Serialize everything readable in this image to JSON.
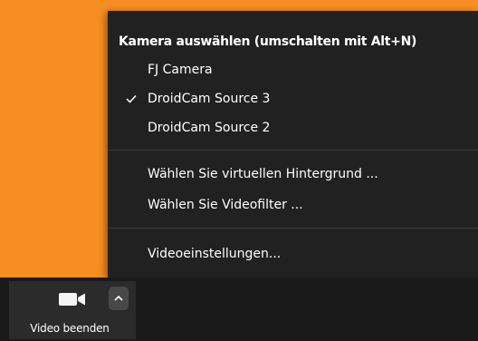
{
  "camera_menu": {
    "header": "Kamera auswählen (umschalten mit Alt+N)",
    "cameras": [
      {
        "label": "FJ Camera",
        "selected": false
      },
      {
        "label": "DroidCam Source 3",
        "selected": true
      },
      {
        "label": "DroidCam Source 2",
        "selected": false
      }
    ],
    "actions": [
      {
        "label": "Wählen Sie virtuellen Hintergrund ..."
      },
      {
        "label": "Wählen Sie Videofilter ..."
      }
    ],
    "settings_label": "Videoeinstellungen..."
  },
  "toolbar": {
    "video_label": "Video beenden",
    "camera_icon": "video-camera-icon",
    "chevron_icon": "chevron-up-icon"
  },
  "colors": {
    "video_background": "#f68e22",
    "menu_background": "#212121",
    "toolbar_background": "#1a1a1a"
  }
}
